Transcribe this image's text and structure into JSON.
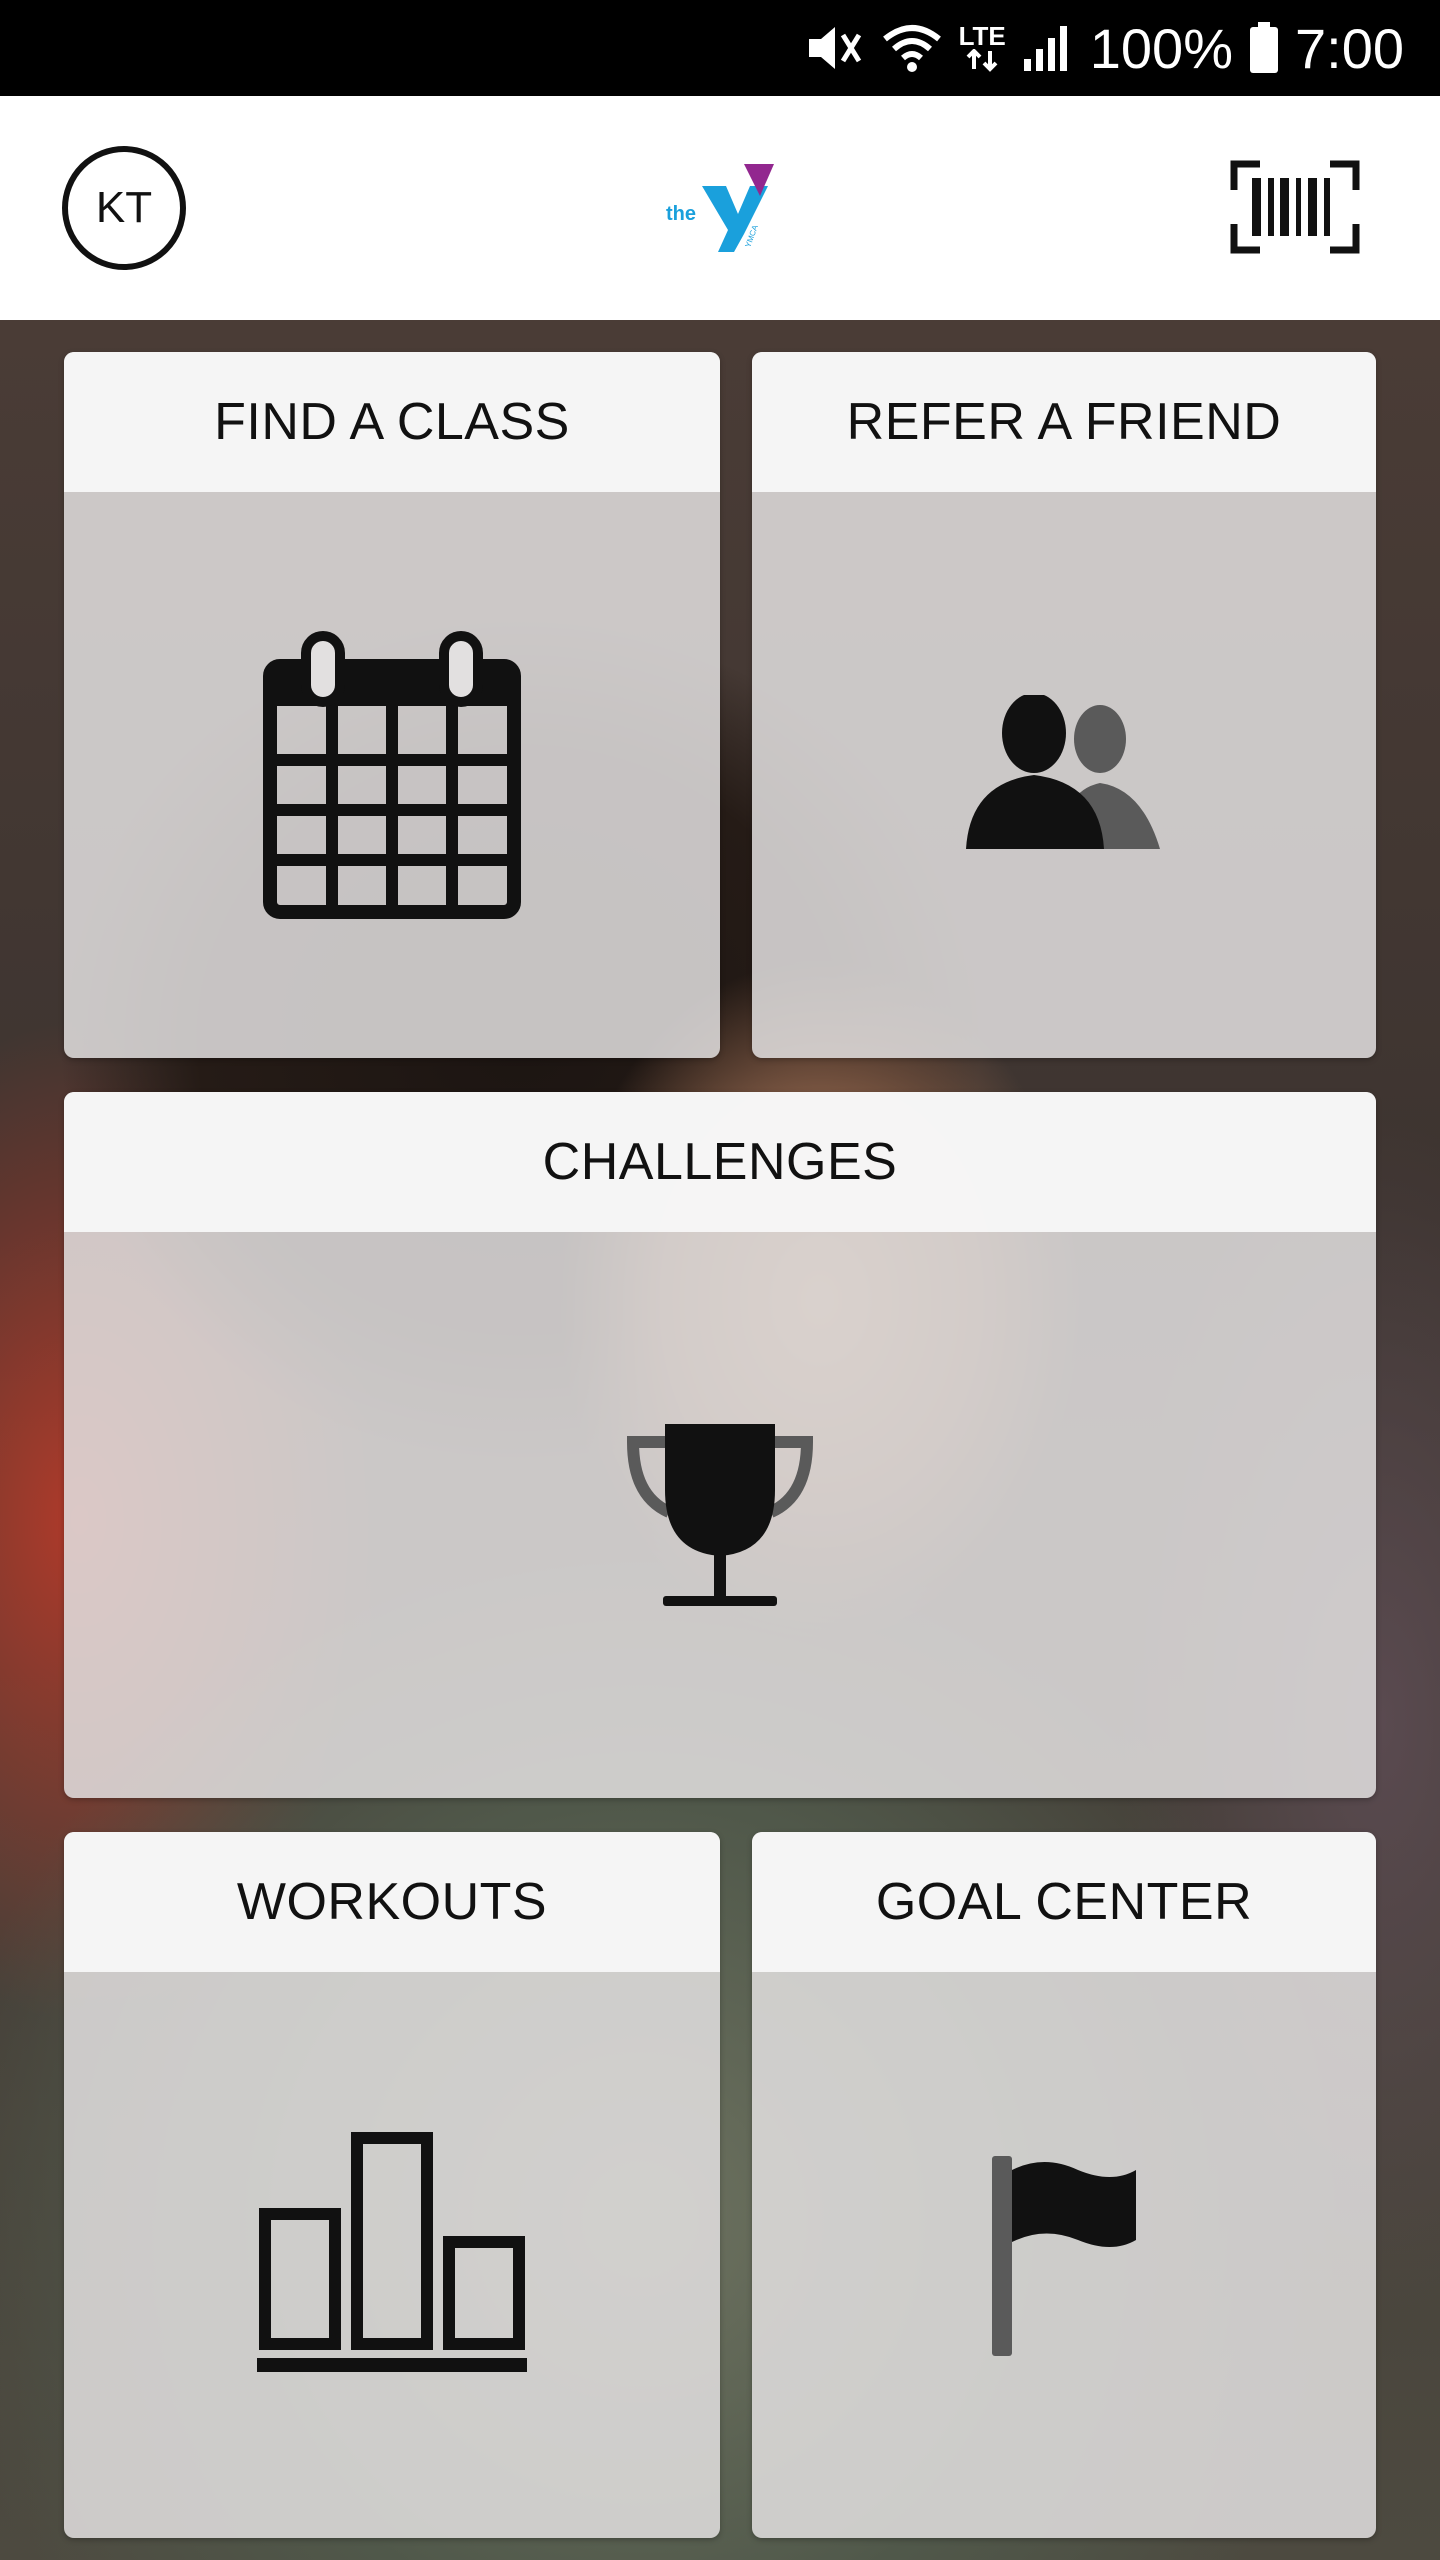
{
  "status_bar": {
    "battery": "100%",
    "time": "7:00",
    "network": "LTE",
    "icons": [
      "mute-icon",
      "wifi-icon",
      "lte-icon",
      "signal-icon",
      "battery-icon"
    ]
  },
  "header": {
    "avatar_initials": "KT",
    "logo_text": "the",
    "logo_sub": "YMCA",
    "logo_colors": {
      "blue": "#1aa0dc",
      "purple": "#92278f"
    }
  },
  "tiles": [
    {
      "title": "FIND A CLASS",
      "icon": "calendar-icon"
    },
    {
      "title": "REFER A FRIEND",
      "icon": "people-icon"
    },
    {
      "title": "CHALLENGES",
      "icon": "trophy-icon"
    },
    {
      "title": "WORKOUTS",
      "icon": "bar-chart-icon"
    },
    {
      "title": "GOAL CENTER",
      "icon": "flag-icon"
    }
  ]
}
